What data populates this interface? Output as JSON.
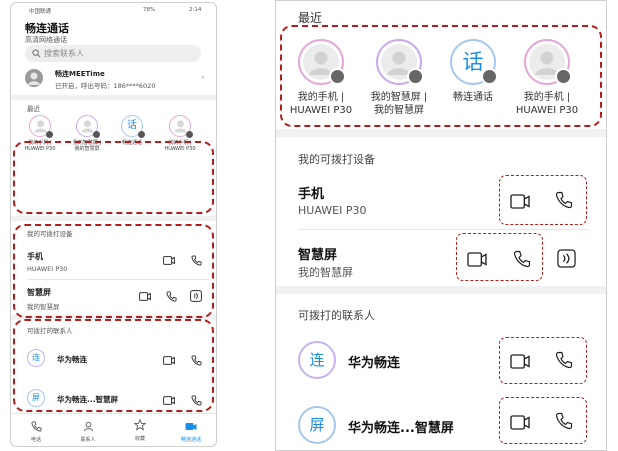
{
  "colors": {
    "accent": "#1a8ee8",
    "dash": "#b41d1d",
    "ring_user": "#e3a8d6",
    "ring_app": "#a7c8ef",
    "ring_screen": "#c9a9ee"
  },
  "phone": {
    "status_left": "中国联通",
    "status_right": "78%",
    "status_time": "2:14",
    "title": "畅连通话",
    "subtitle": "高清网络通话",
    "search_placeholder": "搜索联系人",
    "meetime": {
      "name": "畅连MEETime",
      "status": "已开启，呼出号码：186****6020"
    },
    "recent_title": "最近",
    "recent": [
      {
        "label": "我的手机 | HUAWEI P30"
      },
      {
        "label": "我的智慧屏 | 我的智慧屏"
      },
      {
        "label": "畅连通话",
        "glyph": "话"
      },
      {
        "label": "我的手机 | HUAWEI P30"
      }
    ],
    "devices_title": "我的可拨打设备",
    "devices": [
      {
        "name": "手机",
        "model": "HUAWEI P30"
      },
      {
        "name": "智慧屏",
        "model": "我的智慧屏"
      }
    ],
    "contacts_title": "可拨打的联系人",
    "contacts": [
      {
        "name": "华为畅连",
        "avatar": "连"
      },
      {
        "name": "华为畅连...智慧屏",
        "avatar": "屏"
      }
    ],
    "tabs": [
      {
        "label": "电话"
      },
      {
        "label": "联系人"
      },
      {
        "label": "收藏"
      },
      {
        "label": "畅连通话"
      }
    ]
  },
  "zoom": {
    "recent_title": "最近",
    "recent": [
      {
        "label": "我的手机 |\nHUAWEI P30"
      },
      {
        "label": "我的智慧屏 |\n我的智慧屏"
      },
      {
        "label": "畅连通话",
        "glyph": "话"
      },
      {
        "label": "我的手机 |\nHUAWEI P30"
      }
    ],
    "devices_title": "我的可拨打设备",
    "devices": [
      {
        "name": "手机",
        "model": "HUAWEI P30"
      },
      {
        "name": "智慧屏",
        "model": "我的智慧屏"
      }
    ],
    "contacts_title": "可拨打的联系人",
    "contacts": [
      {
        "name": "华为畅连",
        "avatar": "连"
      },
      {
        "name": "华为畅连...智慧屏",
        "avatar": "屏"
      }
    ]
  }
}
